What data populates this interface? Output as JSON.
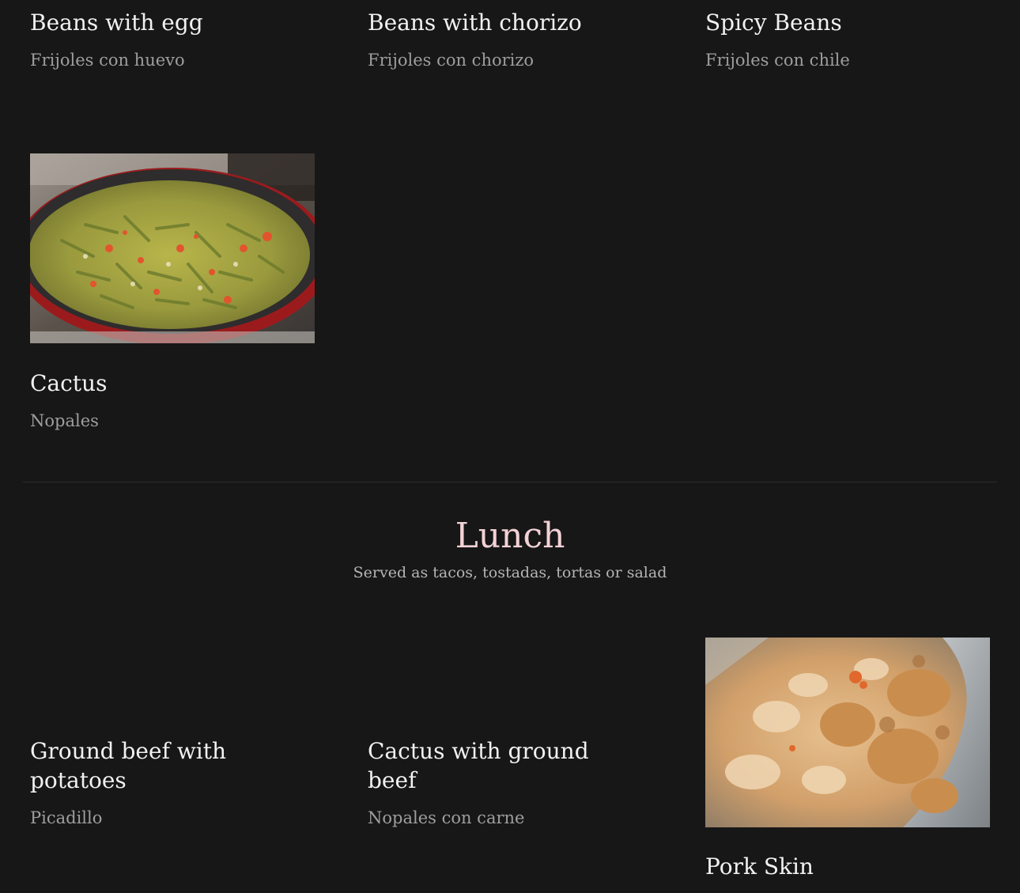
{
  "breakfast_items": [
    {
      "title": "Beans with egg",
      "subtitle": "Frijoles con huevo"
    },
    {
      "title": "Beans with chorizo",
      "subtitle": "Frijoles con chorizo"
    },
    {
      "title": "Spicy Beans",
      "subtitle": "Frijoles con chile"
    },
    {
      "title": "Cactus",
      "subtitle": "Nopales",
      "image": "sauteed-cactus-in-pan-photo"
    }
  ],
  "lunch": {
    "title": "Lunch",
    "subtitle": "Served as tacos, tostadas, tortas or salad",
    "items": [
      {
        "title": "Ground beef with potatoes",
        "subtitle": "Picadillo"
      },
      {
        "title": "Cactus with ground beef",
        "subtitle": "Nopales con carne"
      },
      {
        "title": "Pork Skin",
        "image": "pork-skin-stew-photo"
      }
    ]
  }
}
